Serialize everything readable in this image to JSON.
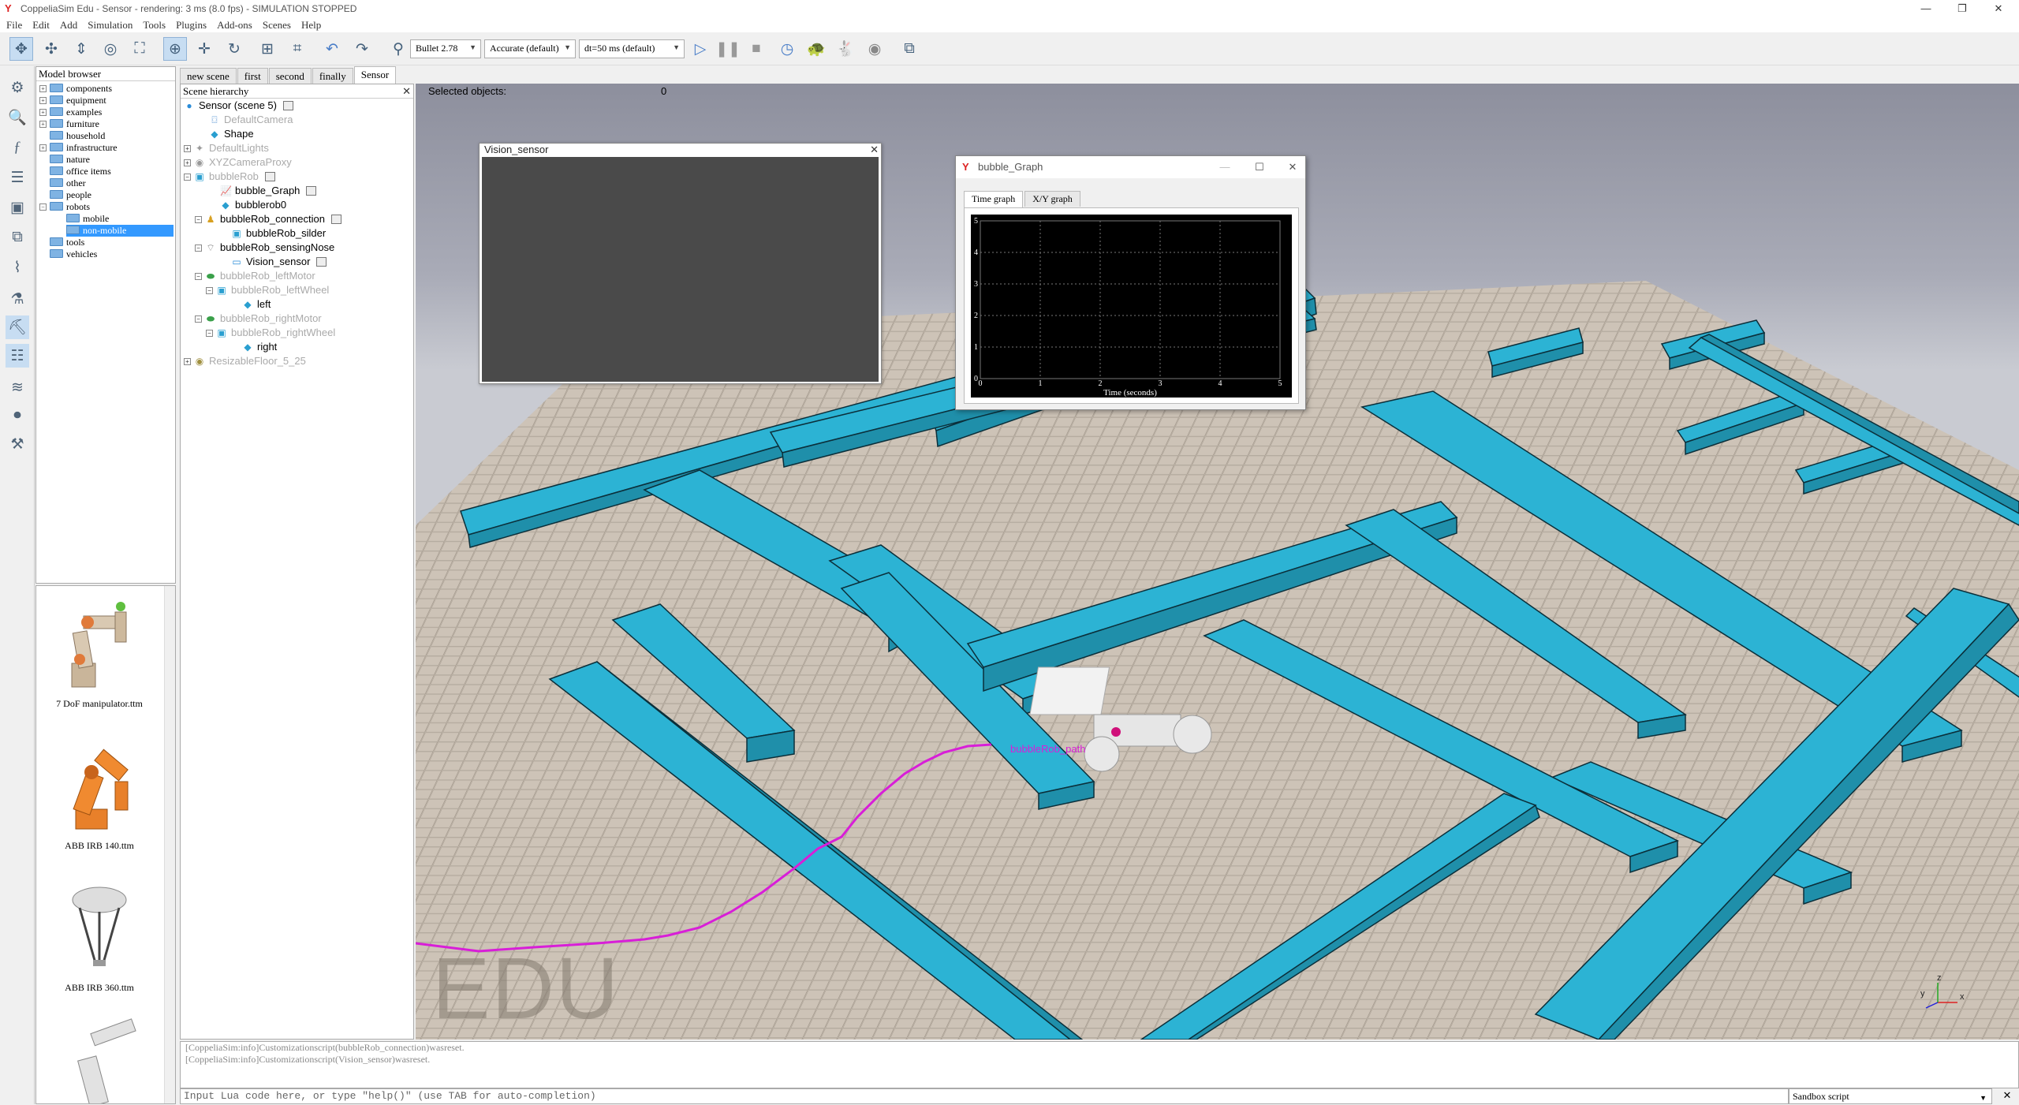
{
  "window": {
    "title": "CoppeliaSim Edu - Sensor - rendering: 3 ms (8.0 fps) - SIMULATION STOPPED"
  },
  "menu": [
    "File",
    "Edit",
    "Add",
    "Simulation",
    "Tools",
    "Plugins",
    "Add-ons",
    "Scenes",
    "Help"
  ],
  "toolbar": {
    "engine": "Bullet 2.78",
    "accuracy": "Accurate (default)",
    "timestep": "dt=50 ms (default)"
  },
  "model_browser": {
    "title": "Model browser",
    "items": [
      {
        "label": "components",
        "expandable": true
      },
      {
        "label": "equipment",
        "expandable": true
      },
      {
        "label": "examples",
        "expandable": true
      },
      {
        "label": "furniture",
        "expandable": true
      },
      {
        "label": "household",
        "expandable": false
      },
      {
        "label": "infrastructure",
        "expandable": true
      },
      {
        "label": "nature",
        "expandable": false
      },
      {
        "label": "office items",
        "expandable": false
      },
      {
        "label": "other",
        "expandable": false
      },
      {
        "label": "people",
        "expandable": false
      },
      {
        "label": "robots",
        "expandable": true,
        "expanded": true
      },
      {
        "label": "mobile",
        "child": true
      },
      {
        "label": "non-mobile",
        "child": true,
        "selected": true
      },
      {
        "label": "tools",
        "expandable": false
      },
      {
        "label": "vehicles",
        "expandable": false
      }
    ],
    "thumbnails": [
      "7 DoF manipulator.ttm",
      "ABB IRB 140.ttm",
      "ABB IRB 360.ttm"
    ]
  },
  "scene_tabs": [
    "new scene",
    "first",
    "second",
    "finally",
    "Sensor"
  ],
  "hierarchy": {
    "title": "Scene hierarchy",
    "rows": [
      {
        "label": "Sensor (scene 5)",
        "icon": "scene-icon",
        "dis": false
      },
      {
        "label": "DefaultCamera",
        "icon": "camera-icon",
        "dis": true
      },
      {
        "label": "Shape",
        "icon": "shape-icon",
        "dis": false
      },
      {
        "label": "DefaultLights",
        "icon": "light-icon",
        "dis": true
      },
      {
        "label": "XYZCameraProxy",
        "icon": "camera-icon",
        "dis": true
      },
      {
        "label": "bubbleRob",
        "icon": "shape-icon",
        "dis": true
      },
      {
        "label": "bubble_Graph",
        "icon": "graph-icon",
        "dis": false
      },
      {
        "label": "bubblerob0",
        "icon": "shape-icon",
        "dis": false
      },
      {
        "label": "bubbleRob_connection",
        "icon": "dummy-icon",
        "dis": false
      },
      {
        "label": "bubbleRob_silder",
        "icon": "shape-icon",
        "dis": false
      },
      {
        "label": "bubbleRob_sensingNose",
        "icon": "proximity-icon",
        "dis": false
      },
      {
        "label": "Vision_sensor",
        "icon": "vision-icon",
        "dis": false
      },
      {
        "label": "bubbleRob_leftMotor",
        "icon": "joint-icon",
        "dis": true
      },
      {
        "label": "bubbleRob_leftWheel",
        "icon": "shape-icon",
        "dis": true
      },
      {
        "label": "left",
        "icon": "shape-icon",
        "dis": false
      },
      {
        "label": "bubbleRob_rightMotor",
        "icon": "joint-icon",
        "dis": true
      },
      {
        "label": "bubbleRob_rightWheel",
        "icon": "shape-icon",
        "dis": true
      },
      {
        "label": "right",
        "icon": "shape-icon",
        "dis": false
      },
      {
        "label": "ResizableFloor_5_25",
        "icon": "shape-icon",
        "dis": true
      }
    ]
  },
  "viewport": {
    "selected_label": "Selected objects:",
    "selected_count": "0",
    "watermark": "EDU",
    "path_label": "bubbleRob_path"
  },
  "vision_window": {
    "title": "Vision_sensor"
  },
  "graph_window": {
    "title": "bubble_Graph",
    "tabs": [
      "Time graph",
      "X/Y graph"
    ],
    "xlabel": "Time (seconds)",
    "xticks": [
      "0",
      "1",
      "2",
      "3",
      "4",
      "5"
    ],
    "yticks": [
      "0",
      "1",
      "2",
      "3",
      "4",
      "5"
    ]
  },
  "chart_data": {
    "type": "line",
    "title": "",
    "xlabel": "Time (seconds)",
    "ylabel": "",
    "xlim": [
      0,
      5
    ],
    "ylim": [
      0,
      5
    ],
    "grid": true,
    "series": []
  },
  "console": {
    "lines": [
      "[CoppeliaSim:info]Customizationscript(bubbleRob_connection)wasreset.",
      "[CoppeliaSim:info]Customizationscript(Vision_sensor)wasreset."
    ],
    "placeholder": "Input Lua code here, or type \"help()\" (use TAB for auto-completion)",
    "script_selector": "Sandbox script"
  },
  "colors": {
    "wall": "#2cb3d4",
    "path": "#e020e0",
    "floor": "#c8beb2"
  }
}
